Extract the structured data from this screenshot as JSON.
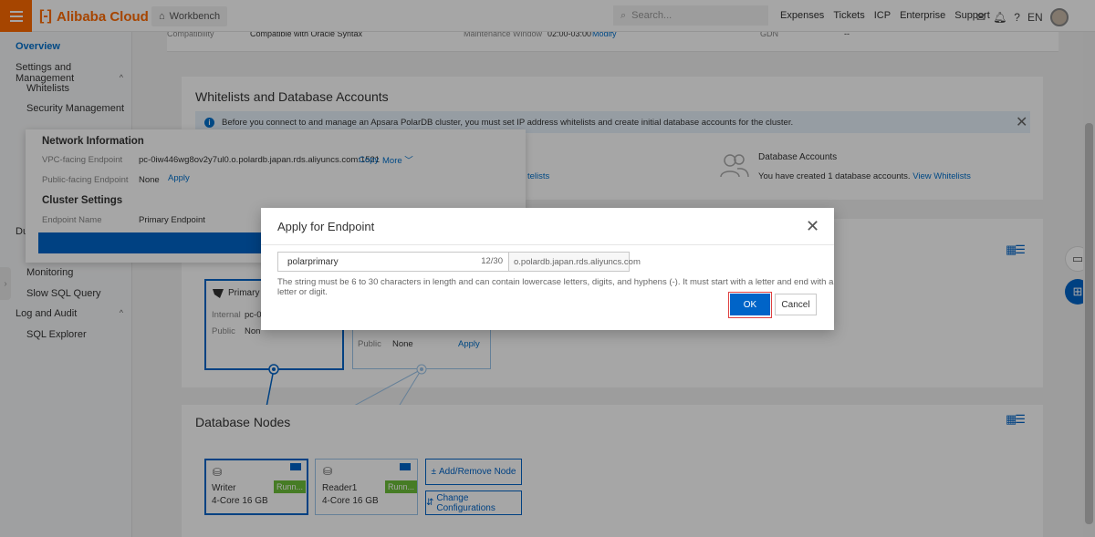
{
  "topbar": {
    "brand": "Alibaba Cloud",
    "workbench": "Workbench",
    "search_placeholder": "Search...",
    "nav": [
      "Expenses",
      "Tickets",
      "ICP",
      "Enterprise",
      "Support"
    ],
    "lang": "EN"
  },
  "sidebar": {
    "overview": "Overview",
    "settings_group": "Settings and Management",
    "whitelists": "Whitelists",
    "security": "Security Management",
    "du": "Du",
    "monitoring": "Monitoring",
    "slow_sql": "Slow SQL Query",
    "log_group": "Log and Audit",
    "sql_explorer": "SQL Explorer"
  },
  "strip": {
    "compat_label": "Compatibility",
    "compat_value": "Compatible with Oracle Syntax",
    "maint_label": "Maintenance Window",
    "maint_value": "02:00-03:00",
    "maint_link": "Modify",
    "gdn_label": "GDN",
    "gdn_value": "--"
  },
  "whitelists": {
    "title": "Whitelists and Database Accounts",
    "info": "Before you connect to and manage an Apsara PolarDB cluster, you must set IP address whitelists and create initial database accounts for the cluster.",
    "partial_link": "telists",
    "accounts_title": "Database Accounts",
    "accounts_text": "You have created 1 database accounts.",
    "accounts_link": "View Whitelists"
  },
  "popover": {
    "network_title": "Network Information",
    "vpc_label": "VPC-facing Endpoint",
    "vpc_value": "pc-0iw446wg8ov2y7ul0.o.polardb.japan.rds.aliyuncs.com:1521",
    "copy": "Copy",
    "more": "More",
    "public_label": "Public-facing Endpoint",
    "public_value": "None",
    "public_apply": "Apply",
    "cluster_title": "Cluster Settings",
    "endpoint_label": "Endpoint Name",
    "endpoint_value": "Primary Endpoint"
  },
  "diagram": {
    "primary_title": "Primary E",
    "internal_label": "Internal",
    "internal_value": "pc-0",
    "public_label": "Public",
    "public_value": "Non",
    "second_public_label": "Public",
    "second_public_value": "None",
    "second_apply": "Apply"
  },
  "nodes": {
    "title": "Database Nodes",
    "writer_name": "Writer",
    "writer_spec": "4-Core 16 GB",
    "writer_status": "Runn...",
    "reader_name": "Reader1",
    "reader_spec": "4-Core 16 GB",
    "reader_status": "Runn...",
    "add_remove": "Add/Remove Node",
    "change_config": "Change Configurations"
  },
  "modal": {
    "title": "Apply for Endpoint",
    "input_value": "polarprimary",
    "counter": "12/30",
    "suffix": "o.polardb.japan.rds.aliyuncs.com",
    "hint": "The string must be 6 to 30 characters in length and can contain lowercase letters, digits, and hyphens (-). It must start with a letter and end with a letter or digit.",
    "ok": "OK",
    "cancel": "Cancel"
  },
  "colors": {
    "brand": "#ff6a00",
    "primary": "#0064c8",
    "running": "#6cbf3a",
    "highlight": "#e04040"
  }
}
